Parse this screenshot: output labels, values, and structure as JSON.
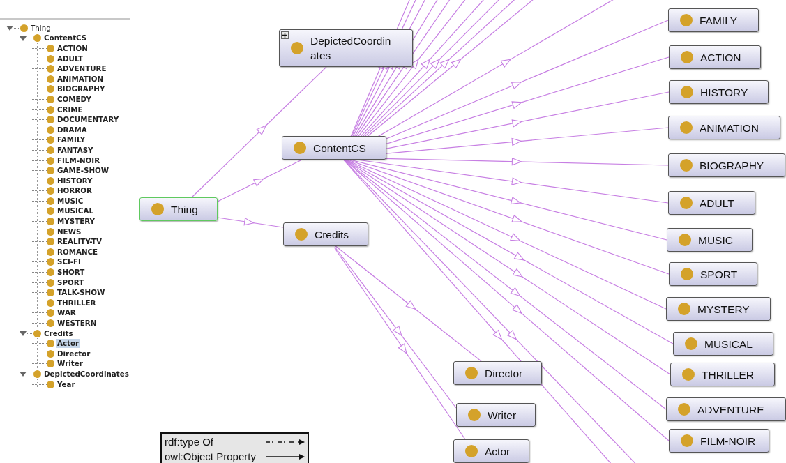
{
  "tree": {
    "items": [
      {
        "label": "Thing",
        "expanded": true,
        "selected": false,
        "children": [
          {
            "label": "ContentCS",
            "expanded": true,
            "selected": false,
            "children": [
              {
                "label": "ACTION",
                "selected": false
              },
              {
                "label": "ADULT",
                "selected": false
              },
              {
                "label": "ADVENTURE",
                "selected": false
              },
              {
                "label": "ANIMATION",
                "selected": false
              },
              {
                "label": "BIOGRAPHY",
                "selected": false
              },
              {
                "label": "COMEDY",
                "selected": false
              },
              {
                "label": "CRIME",
                "selected": false
              },
              {
                "label": "DOCUMENTARY",
                "selected": false
              },
              {
                "label": "DRAMA",
                "selected": false
              },
              {
                "label": "FAMILY",
                "selected": false
              },
              {
                "label": "FANTASY",
                "selected": false
              },
              {
                "label": "FILM-NOIR",
                "selected": false
              },
              {
                "label": "GAME-SHOW",
                "selected": false
              },
              {
                "label": "HISTORY",
                "selected": false
              },
              {
                "label": "HORROR",
                "selected": false
              },
              {
                "label": "MUSIC",
                "selected": false
              },
              {
                "label": "MUSICAL",
                "selected": false
              },
              {
                "label": "MYSTERY",
                "selected": false
              },
              {
                "label": "NEWS",
                "selected": false
              },
              {
                "label": "REALITY-TV",
                "selected": false
              },
              {
                "label": "ROMANCE",
                "selected": false
              },
              {
                "label": "SCI-FI",
                "selected": false
              },
              {
                "label": "SHORT",
                "selected": false
              },
              {
                "label": "SPORT",
                "selected": false
              },
              {
                "label": "TALK-SHOW",
                "selected": false
              },
              {
                "label": "THRILLER",
                "selected": false
              },
              {
                "label": "WAR",
                "selected": false
              },
              {
                "label": "WESTERN",
                "selected": false
              }
            ]
          },
          {
            "label": "Credits",
            "expanded": true,
            "selected": false,
            "children": [
              {
                "label": "Actor",
                "selected": true
              },
              {
                "label": "Director",
                "selected": false
              },
              {
                "label": "Writer",
                "selected": false
              }
            ]
          },
          {
            "label": "DepictedCoordinates",
            "expanded": true,
            "selected": false,
            "children": [
              {
                "label": "Year",
                "selected": false
              }
            ]
          }
        ]
      }
    ]
  },
  "graph": {
    "nodes": [
      {
        "label": "Thing",
        "selected": true,
        "expandable": false,
        "children": [
          {
            "label": "DepictedCoordinates",
            "selected": false,
            "expandable": true
          },
          {
            "label": "ContentCS",
            "selected": false,
            "expandable": false,
            "children": [
              {
                "label": "FAMILY",
                "selected": false,
                "expandable": false
              },
              {
                "label": "ACTION",
                "selected": false,
                "expandable": false
              },
              {
                "label": "HISTORY",
                "selected": false,
                "expandable": false
              },
              {
                "label": "ANIMATION",
                "selected": false,
                "expandable": false
              },
              {
                "label": "BIOGRAPHY",
                "selected": false,
                "expandable": false
              },
              {
                "label": "ADULT",
                "selected": false,
                "expandable": false
              },
              {
                "label": "MUSIC",
                "selected": false,
                "expandable": false
              },
              {
                "label": "SPORT",
                "selected": false,
                "expandable": false
              },
              {
                "label": "MYSTERY",
                "selected": false,
                "expandable": false
              },
              {
                "label": "MUSICAL",
                "selected": false,
                "expandable": false
              },
              {
                "label": "THRILLER",
                "selected": false,
                "expandable": false
              },
              {
                "label": "ADVENTURE",
                "selected": false,
                "expandable": false
              },
              {
                "label": "FILM-NOIR",
                "selected": false,
                "expandable": false
              }
            ]
          },
          {
            "label": "Credits",
            "selected": false,
            "expandable": false,
            "children": [
              {
                "label": "Director",
                "selected": false,
                "expandable": false
              },
              {
                "label": "Writer",
                "selected": false,
                "expandable": false
              },
              {
                "label": "Actor",
                "selected": false,
                "expandable": false
              }
            ]
          }
        ]
      }
    ]
  },
  "legend": [
    {
      "label": "rdf:type Of",
      "kind": "dashed"
    },
    {
      "label": "owl:Object Property",
      "kind": "solid"
    }
  ]
}
